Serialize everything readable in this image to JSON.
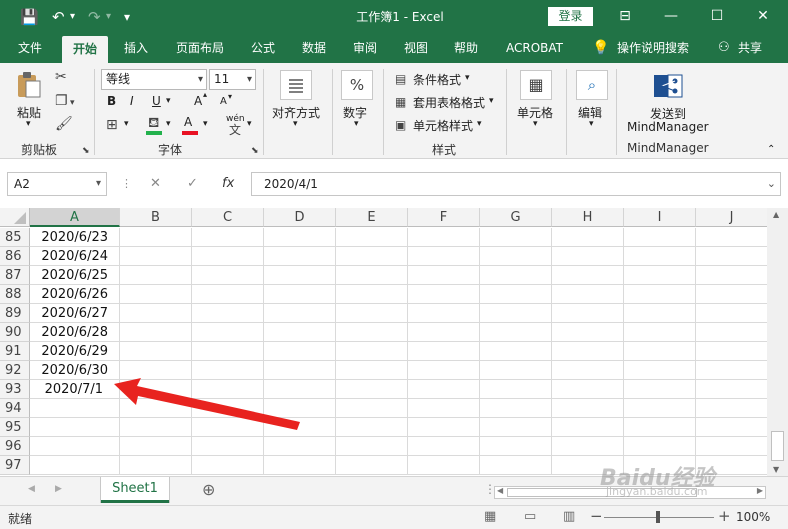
{
  "titlebar": {
    "title": "工作簿1  -  Excel",
    "login": "登录",
    "qa_save": "💾",
    "qa_undo": "↶",
    "qa_redo": "↷",
    "qa_customize": "▾",
    "ribbon_display": "⊟",
    "minimize": "—",
    "maximize": "☐",
    "close": "✕"
  },
  "tabs": [
    "文件",
    "开始",
    "插入",
    "页面布局",
    "公式",
    "数据",
    "审阅",
    "视图",
    "帮助",
    "ACROBAT"
  ],
  "tell_me": "操作说明搜索",
  "share": "共享",
  "ribbon": {
    "paste": "粘贴",
    "clipboard": "剪贴板",
    "font_name": "等线",
    "font_size": "11",
    "font_group": "字体",
    "bold": "B",
    "italic": "I",
    "underline": "U",
    "grow_font": "A",
    "shrink_font": "A",
    "font_color": "A",
    "wen": "wén",
    "alignment": "对齐方式",
    "number": "数字",
    "conditional_format": "条件格式",
    "table_format": "套用表格格式",
    "cell_style": "单元格样式",
    "styles_group": "样式",
    "cells": "单元格",
    "editing": "编辑",
    "send_to": "发送到",
    "mindmanager": "MindManager",
    "mindmanager_group": "MindManager"
  },
  "formula": {
    "name_box": "A2",
    "cancel": "✕",
    "enter": "✓",
    "fx": "fx",
    "value": "2020/4/1"
  },
  "grid": {
    "columns": [
      "A",
      "B",
      "C",
      "D",
      "E",
      "F",
      "G",
      "H",
      "I",
      "J"
    ],
    "rows": [
      {
        "num": "85",
        "a": "2020/6/23"
      },
      {
        "num": "86",
        "a": "2020/6/24"
      },
      {
        "num": "87",
        "a": "2020/6/25"
      },
      {
        "num": "88",
        "a": "2020/6/26"
      },
      {
        "num": "89",
        "a": "2020/6/27"
      },
      {
        "num": "90",
        "a": "2020/6/28"
      },
      {
        "num": "91",
        "a": "2020/6/29"
      },
      {
        "num": "92",
        "a": "2020/6/30"
      },
      {
        "num": "93",
        "a": "2020/7/1"
      },
      {
        "num": "94",
        "a": ""
      },
      {
        "num": "95",
        "a": ""
      },
      {
        "num": "96",
        "a": ""
      },
      {
        "num": "97",
        "a": ""
      }
    ]
  },
  "sheets": [
    "Sheet1"
  ],
  "add_sheet": "⊕",
  "status": {
    "ready": "就绪",
    "zoom_minus": "−",
    "zoom_plus": "+",
    "zoom": "100%"
  },
  "watermark": {
    "brand": "Baidu经验",
    "url": "jingyan.baidu.com"
  },
  "colors": {
    "excel_green": "#217346",
    "arrow_red": "#e8231f"
  }
}
